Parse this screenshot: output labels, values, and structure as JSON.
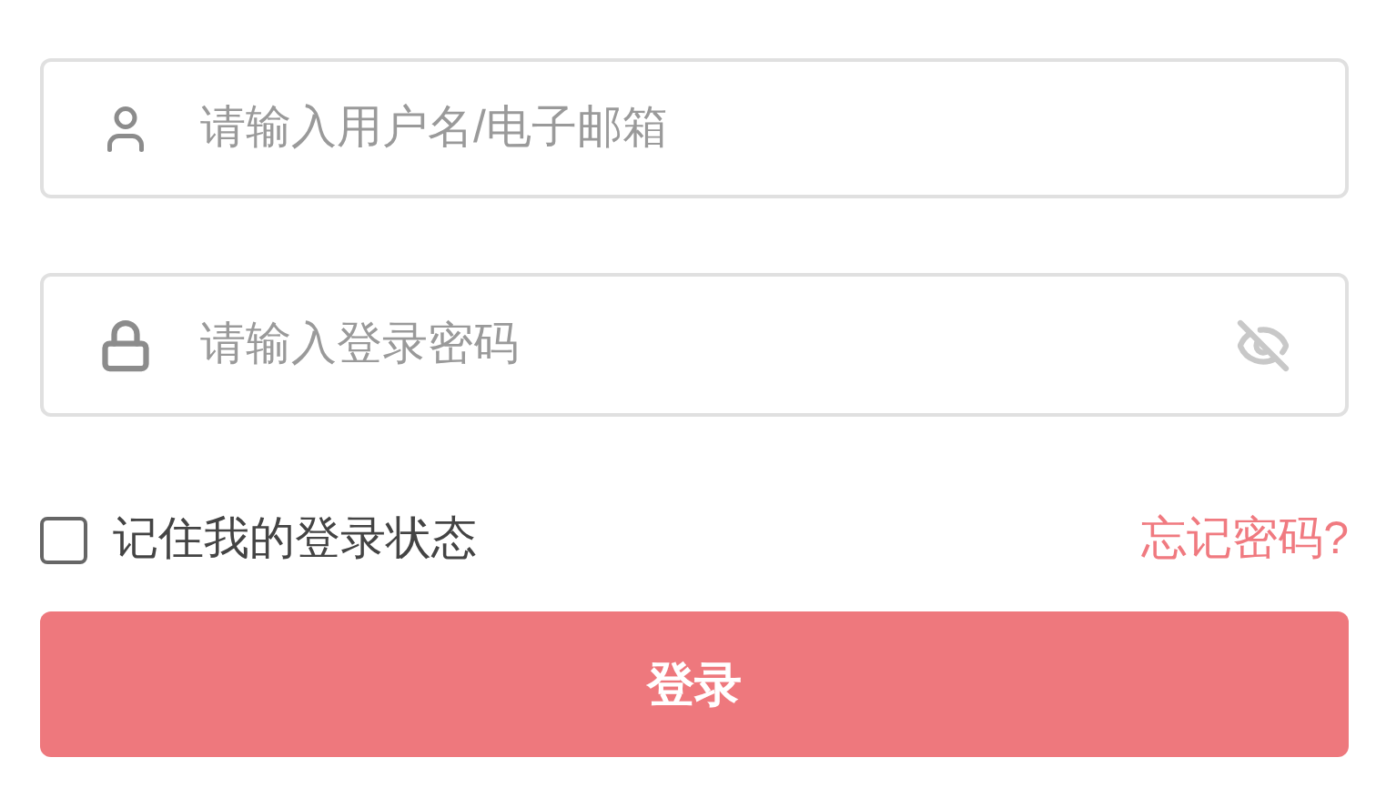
{
  "username": {
    "placeholder": "请输入用户名/电子邮箱"
  },
  "password": {
    "placeholder": "请输入登录密码",
    "visible": false
  },
  "remember": {
    "label": "记住我的登录状态",
    "checked": false
  },
  "forgot_link": "忘记密码?",
  "login_button": "登录"
}
